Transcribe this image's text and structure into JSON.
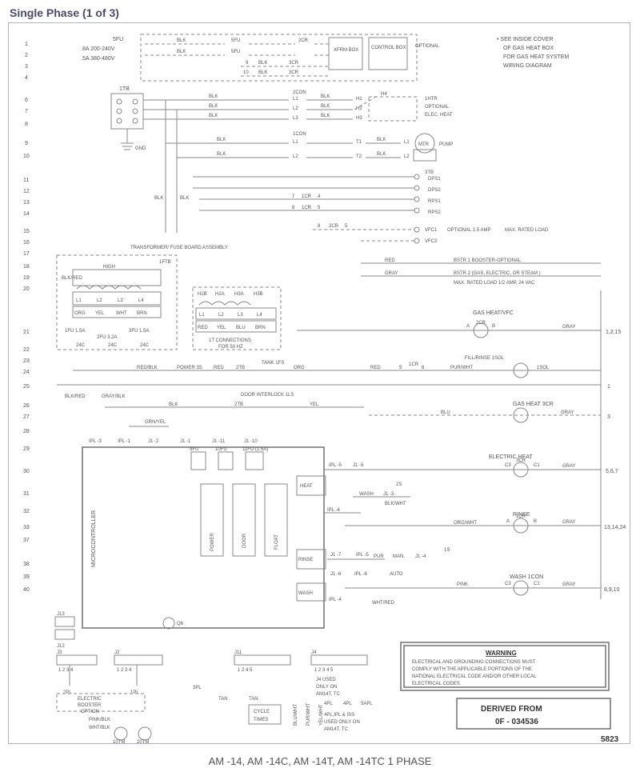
{
  "title": "Single Phase (1 of 3)",
  "footer": "AM -14, AM -14C, AM -14T, AM -14TC 1 PHASE",
  "bottom_right_num": "5823",
  "note_top_right": [
    "• SEE INSIDE COVER",
    "OF GAS HEAT BOX",
    "FOR GAS HEAT SYSTEM",
    "WIRING DIAGRAM"
  ],
  "derived": {
    "l1": "DERIVED FROM",
    "l2": "0F - 034536"
  },
  "warning": {
    "title": "WARNING",
    "lines": [
      "ELECTRICAL AND GROUNDING CONNECTIONS MUST",
      "COMPLY WITH THE APPLICABLE PORTIONS OF THE",
      "NATIONAL ELECTRICAL CODE AND/OR OTHER LOCAL",
      "ELECTRICAL CODES."
    ]
  },
  "left_nums_top": [
    "1",
    "2",
    "3",
    "4",
    "6",
    "7",
    "8",
    "9",
    "10",
    "11",
    "12",
    "13",
    "14",
    "15",
    "16",
    "17",
    "18",
    "19",
    "20",
    "21",
    "22",
    "23",
    "24",
    "25",
    "26",
    "27",
    "28",
    "29",
    "30",
    "31",
    "32",
    "33",
    "37",
    "38",
    "39",
    "40"
  ],
  "right_refs": {
    "r21": "1,2,15",
    "r25": "1",
    "r26": "3",
    "r30": "5,6,7",
    "r33": "13,14,24",
    "r39": "8,9,10"
  },
  "header_left": {
    "l1": "5FU",
    "l2": ".8A 200-240V",
    "l3": ".5A 380-480V"
  },
  "labels": {
    "fu5a": "5FU",
    "fu5b": "5FU",
    "cr2": "2CR",
    "xfrm": "XFRM BOX",
    "control": "CONTROL BOX",
    "rows_9_10": [
      "9",
      "10",
      "3CR",
      "3CR",
      "BLK",
      "BLK"
    ],
    "tb1": "1TB",
    "blk": "BLK",
    "gnd": "GND",
    "con2": "2CON",
    "h1": "H1",
    "h2": "H2",
    "h3": "H3",
    "h4": "H4",
    "htr1": "1HTR",
    "opt": "OPTIONAL",
    "elec_heat": "ELEC. HEAT",
    "con1": "1CON",
    "t1": "T1",
    "t2": "T2",
    "l1": "L1",
    "l2": "L2",
    "mtr": "MTR",
    "pump": "PUMP",
    "tb3": "3TB",
    "dps1": "DPS1",
    "dps2": "DPS2",
    "rps1": "RPS1",
    "rps2": "RPS2",
    "cr1_7": [
      "7",
      "1CR",
      "4"
    ],
    "cr1_8": [
      "8",
      "1CR",
      "5"
    ],
    "cr2_8": [
      "8",
      "2CR",
      "5"
    ],
    "vfc1": "VFC1",
    "vfc2": "VFC2",
    "opt15": "OPTIONAL 1.5 AMP",
    "max_rated": "MAX. RATED LOAD",
    "ftb1": "1FTB",
    "tfb": "TRANSFORMER/ FUSE BOARD ASSEMBLY",
    "bstr1": "BSTR 1 BOOSTER-OPTIONAL",
    "bstr2": "BSTR 2 (GAS, ELECTRIC, OR STEAM )",
    "bstr2b": "MAX. RATED LOAD 1/2 AMP, 24 VAC",
    "gasheat": "GAS HEAT/VFC",
    "a": "A",
    "b": "B",
    "cr2b": "2CR",
    "tr1": {
      "top": "HIGH",
      "colors": [
        "BLK/RED"
      ],
      "sec": [
        "L1",
        "L2",
        "L3",
        "L4"
      ],
      "wires": [
        "ORG",
        "YEL",
        "WHT",
        "BRN"
      ],
      "fu": [
        "1FU 1.5A",
        "2FU 3.2A",
        "3FU 1.5A"
      ],
      "c24": "24C"
    },
    "tr2": {
      "top": [
        "H2B",
        "H2A",
        "H3A",
        "H3B"
      ],
      "c": [
        "L1",
        "L2",
        "L3",
        "L4"
      ],
      "w": [
        "RED",
        "YEL",
        "BLU",
        "BRN"
      ],
      "note": [
        "1T CONNECTIONS",
        "FOR 50 HZ"
      ]
    },
    "row24": {
      "power3s": "POWER 3S",
      "redblk": "RED/BLK",
      "red": "RED",
      "tb2": "2TB",
      "tank1fs": "TANK 1FS",
      "org": "ORG",
      "red5": "5",
      "cr1_6": [
        "1CR",
        "6"
      ],
      "fill": "FILL/RINSE 1SOL",
      "pur": "PUR/WHT",
      "sol1": "1SOL"
    },
    "row25": {
      "blkred": "BLK/RED",
      "grayblk": "GRAY/BLK",
      "doorint": "DOOR INTERLOCK 1LS",
      "org": "ORG",
      "tb2": "2TB",
      "blk": "BLK",
      "yel": "YEL",
      "gasheat2": "GAS HEAT 3CR"
    },
    "row28": {
      "grnyel": "GRN/YEL",
      "ipl3": "IPL -3",
      "ipl1": "IPL -1",
      "j1s": [
        "J1 -2",
        "J1 -1",
        "J1 -11",
        "J1 -10"
      ]
    },
    "row29": {
      "fu9": "9FU",
      "fu10": "10FU",
      "fu11": "11FU (1.5A)",
      "ipl5": "IPL -5",
      "j1_5": "J1 -5",
      "elecheat": "ELECTRIC HEAT",
      "c3": "C3",
      "cr3": "3CR",
      "c1": "C1"
    },
    "row31": {
      "heat": "HEAT",
      "s2": "2S",
      "wash": "WASH",
      "j1_3": "J1 -3",
      "blkwht": "BLK/WHT",
      "ipl4": "IPL -4",
      "rinse": "RINSE",
      "a": "A",
      "cr1": "1CR",
      "b": "B",
      "org": "ORG/WHT"
    },
    "row37": {
      "rinse": "RINSE",
      "j1_7": "J1 -7",
      "ipl5": "IPL -5",
      "pur": "PUR",
      "man": "MAN.",
      "j1_4": "J1 -4",
      "s1": "1S",
      "washicon": "WASH 1CON",
      "c3": "C3",
      "c1": "C1",
      "pink": "PINK"
    },
    "row39": {
      "auto": "AUTO",
      "j1_6": "J1 -6",
      "ipl6": "IPL -6",
      "wash": "WASH",
      "ipl4": "IPL -4",
      "whtred": "WHT/RED"
    },
    "mcu": "MICROCONTROLLER",
    "power": "POWER",
    "door": "DOOR",
    "float": "FLOAT",
    "j13": "J13",
    "j12": "J12",
    "q6": "Q6",
    "j3": "J3",
    "j3p": "1 2 3 4",
    "j2": "J2",
    "j2p": "1 2 3 4",
    "j11": "J11",
    "j11p": "1  2  4  5",
    "j4": "J4",
    "j4p": "1 2 3 4 5",
    "j4note": [
      "J4 USED",
      "ONLY ON",
      "AM14T, TC"
    ],
    "pl2": "2PL",
    "pl1": "1PL",
    "pl3": "3PL",
    "pl4a": "4PL",
    "pl4b": "4PL",
    "pl5": "5APL",
    "ebo": [
      "ELECTRIC",
      "BOOSTER",
      "OPTION"
    ],
    "pinkblk": "PINK/BLK",
    "whtblk": "WHT/BLK",
    "tan": "TAN",
    "cycle": [
      "CYCLE",
      "TIMES"
    ],
    "note4pl": [
      "4PL,IPL & ISS",
      "USED ONLY ON",
      "AM14T, TC"
    ],
    "tm10": "10TM",
    "tm20": "20TM",
    "vcols": [
      "BLU/WHT",
      "PUR/WHT",
      "YEL/WHT"
    ],
    "gray": "GRAY",
    "red": "RED",
    "wht": "WHT",
    "blu": "BLU"
  }
}
